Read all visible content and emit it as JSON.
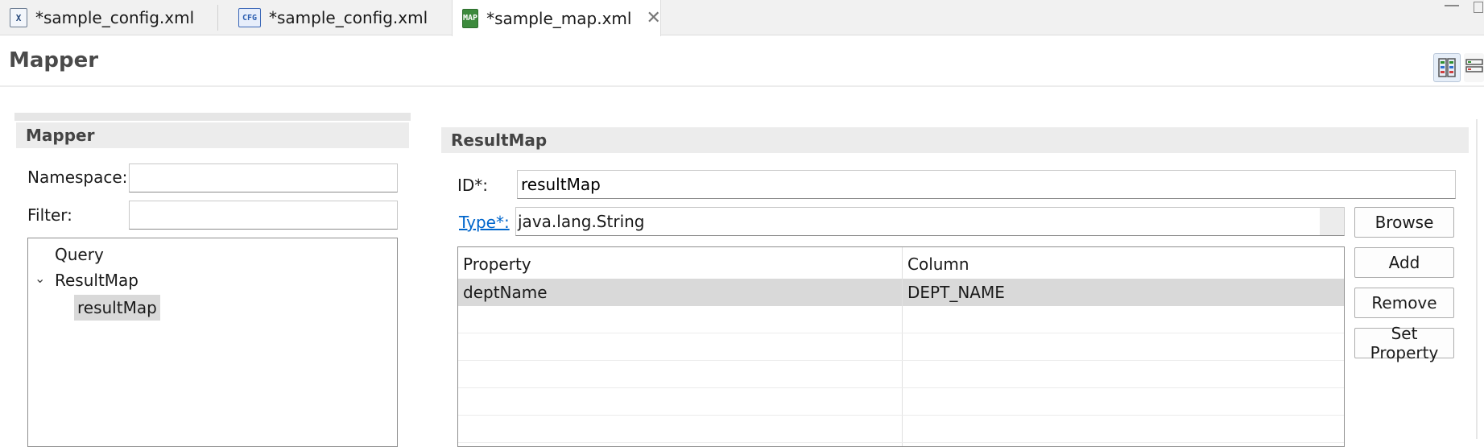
{
  "tabs": [
    {
      "label": "*sample_config.xml",
      "icon": "xml-file-icon",
      "icon_text": "X"
    },
    {
      "label": "*sample_config.xml",
      "icon": "config-file-icon",
      "icon_text": "CFG"
    },
    {
      "label": "*sample_map.xml",
      "icon": "map-file-icon",
      "icon_text": "MAP",
      "active": true
    }
  ],
  "header": {
    "title": "Mapper"
  },
  "left_panel": {
    "section_title": "Mapper",
    "namespace_label": "Namespace:",
    "namespace_value": "",
    "filter_label": "Filter:",
    "filter_value": "",
    "tree": [
      {
        "label": "Query",
        "level": 0
      },
      {
        "label": "ResultMap",
        "level": 0,
        "expanded": true
      },
      {
        "label": "resultMap",
        "level": 1,
        "selected": true
      }
    ]
  },
  "right_panel": {
    "section_title": "ResultMap",
    "id_label": "ID*:",
    "id_value": "resultMap",
    "type_label": "Type*:",
    "type_value": "java.lang.String",
    "buttons": {
      "browse": "Browse",
      "add": "Add",
      "remove": "Remove",
      "set_property": "Set Property"
    },
    "table": {
      "columns": [
        "Property",
        "Column"
      ],
      "rows": [
        [
          "deptName",
          "DEPT_NAME"
        ]
      ]
    }
  },
  "colors": {
    "selection": "#d9d9d9",
    "link": "#0066cc",
    "section_header": "#ececec"
  }
}
